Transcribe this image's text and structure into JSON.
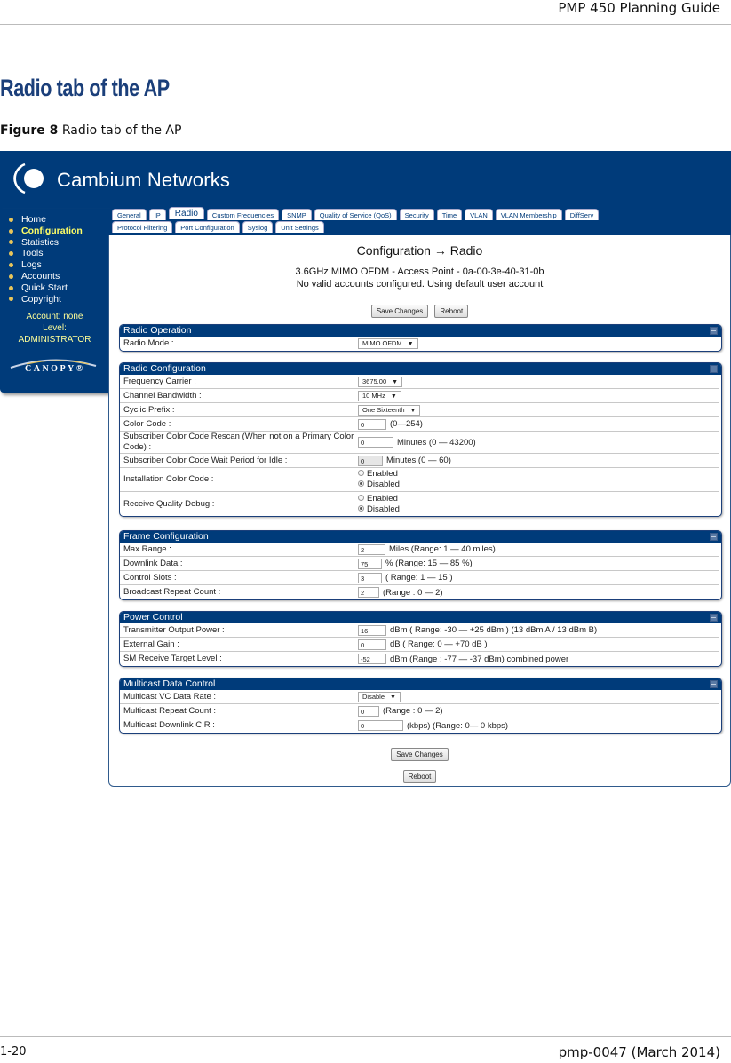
{
  "document": {
    "header": "PMP 450 Planning Guide",
    "section_title": "Radio tab of the AP",
    "figure_label": "Figure 8",
    "figure_caption": "Radio tab of the AP",
    "footer_page": "1-20",
    "footer_doc": "pmp-0047 (March 2014)"
  },
  "app": {
    "brand": "Cambium Networks",
    "nav": [
      {
        "label": "Home",
        "active": false
      },
      {
        "label": "Configuration",
        "active": true
      },
      {
        "label": "Statistics",
        "active": false
      },
      {
        "label": "Tools",
        "active": false
      },
      {
        "label": "Logs",
        "active": false
      },
      {
        "label": "Accounts",
        "active": false
      },
      {
        "label": "Quick Start",
        "active": false
      },
      {
        "label": "Copyright",
        "active": false
      }
    ],
    "account_line": "Account: none",
    "level_line": "Level:",
    "level_value": "ADMINISTRATOR",
    "canopy_logo": "CANOPY®",
    "tabs_row1": [
      "General",
      "IP",
      "Radio",
      "Custom Frequencies",
      "SNMP",
      "Quality of Service (QoS)",
      "Security",
      "Time",
      "VLAN",
      "VLAN Membership",
      "DiffServ"
    ],
    "tabs_row2": [
      "Protocol Filtering",
      "Port Configuration",
      "Syslog",
      "Unit Settings"
    ],
    "active_tab": "Radio",
    "page_heading": "Configuration → Radio",
    "device_line": "3.6GHz MIMO OFDM - Access Point - 0a-00-3e-40-31-0b",
    "account_warning": "No valid accounts configured. Using default user account",
    "buttons": {
      "save": "Save Changes",
      "reboot": "Reboot"
    },
    "groups": {
      "radio_operation": {
        "title": "Radio Operation",
        "radio_mode": {
          "label": "Radio Mode :",
          "value": "MIMO OFDM"
        }
      },
      "radio_configuration": {
        "title": "Radio Configuration",
        "frequency_carrier": {
          "label": "Frequency Carrier :",
          "value": "3675.00"
        },
        "channel_bandwidth": {
          "label": "Channel Bandwidth :",
          "value": "10 MHz"
        },
        "cyclic_prefix": {
          "label": "Cyclic Prefix :",
          "value": "One Sixteenth"
        },
        "color_code": {
          "label": "Color Code :",
          "value": "0",
          "hint": "(0—254)"
        },
        "cc_rescan": {
          "label": "Subscriber Color Code Rescan (When not on a Primary Color Code) :",
          "value": "0",
          "hint": "Minutes (0 — 43200)"
        },
        "cc_wait": {
          "label": "Subscriber Color Code Wait Period for Idle :",
          "value": "0",
          "hint": "Minutes (0 — 60)"
        },
        "install_cc": {
          "label": "Installation Color Code :",
          "options": [
            "Enabled",
            "Disabled"
          ],
          "selected": "Disabled"
        },
        "rx_quality_debug": {
          "label": "Receive Quality Debug :",
          "options": [
            "Enabled",
            "Disabled"
          ],
          "selected": "Disabled"
        }
      },
      "frame_configuration": {
        "title": "Frame Configuration",
        "max_range": {
          "label": "Max Range :",
          "value": "2",
          "hint": "Miles (Range: 1 — 40 miles)"
        },
        "downlink_data": {
          "label": "Downlink Data :",
          "value": "75",
          "hint": "% (Range: 15 — 85 %)"
        },
        "control_slots": {
          "label": "Control Slots :",
          "value": "3",
          "hint": "( Range: 1 — 15 )"
        },
        "broadcast_repeat": {
          "label": "Broadcast Repeat Count :",
          "value": "2",
          "hint": "(Range : 0 — 2)"
        }
      },
      "power_control": {
        "title": "Power Control",
        "tx_power": {
          "label": "Transmitter Output Power :",
          "value": "16",
          "hint": "dBm ( Range: -30 — +25 dBm ) (13 dBm A / 13 dBm B)"
        },
        "ext_gain": {
          "label": "External Gain :",
          "value": "0",
          "hint": "dB ( Range: 0 — +70 dB )"
        },
        "sm_rx_target": {
          "label": "SM Receive Target Level :",
          "value": "-52",
          "hint": "dBm (Range : -77 — -37 dBm) combined power"
        }
      },
      "multicast": {
        "title": "Multicast Data Control",
        "vc_rate": {
          "label": "Multicast VC Data Rate :",
          "value": "Disable"
        },
        "repeat_count": {
          "label": "Multicast Repeat Count :",
          "value": "0",
          "hint": "(Range : 0 — 2)"
        },
        "downlink_cir": {
          "label": "Multicast Downlink CIR :",
          "value": "0",
          "hint": "(kbps) (Range: 0— 0 kbps)"
        }
      }
    },
    "colors": {
      "brand_blue": "#003b7a",
      "nav_active": "#ffff66",
      "title_blue": "#1b3f7a"
    }
  }
}
